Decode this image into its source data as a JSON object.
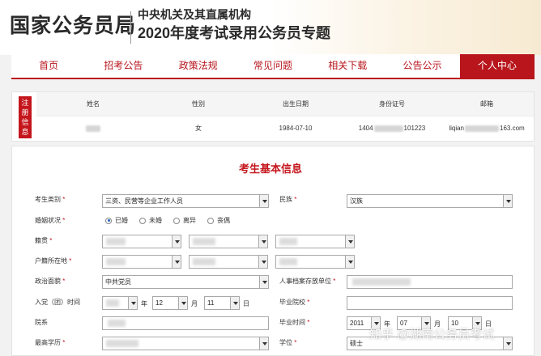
{
  "header": {
    "org_name": "国家公务员局",
    "sub_title": "中央机关及其直属机构",
    "main_title": "2020年度考试录用公务员专题"
  },
  "nav": [
    "首页",
    "招考公告",
    "政策法规",
    "常见问题",
    "相关下载",
    "公告公示",
    "个人中心"
  ],
  "info_bar": {
    "tag": "注册信息",
    "columns": [
      "姓名",
      "性别",
      "出生日期",
      "身份证号",
      "邮箱"
    ],
    "gender": "女",
    "birth_date": "1984-07-10",
    "id_prefix": "1404",
    "id_suffix": "101223",
    "email_prefix": "liqian",
    "email_suffix": "163.com"
  },
  "form": {
    "title": "考生基本信息",
    "labels": {
      "candidate_type": "考生类别",
      "ethnicity": "民族",
      "marital": "婚姻状况",
      "native_place": "籍贯",
      "hukou": "户籍所在地",
      "politics": "政治面貌",
      "archive_unit": "人事档案存放单位",
      "join_time": "入党（团）时间",
      "school": "毕业院校",
      "department": "院系",
      "grad_time": "毕业时间",
      "education": "最高学历",
      "degree": "学位"
    },
    "required_mark": "*",
    "candidate_type_value": "三资、民营等企业工作人员",
    "ethnicity_value": "汉族",
    "marital_options": [
      "已婚",
      "未婚",
      "离异",
      "丧偶"
    ],
    "marital_selected": "已婚",
    "politics_value": "中共党员",
    "join_month": "12",
    "join_day": "11",
    "grad_year": "2011",
    "grad_month": "07",
    "grad_day": "10",
    "degree_value": "硕士",
    "unit_year": "年",
    "unit_month": "月",
    "unit_day": "日"
  },
  "watermark": "知乎 @湖南公务员考试"
}
